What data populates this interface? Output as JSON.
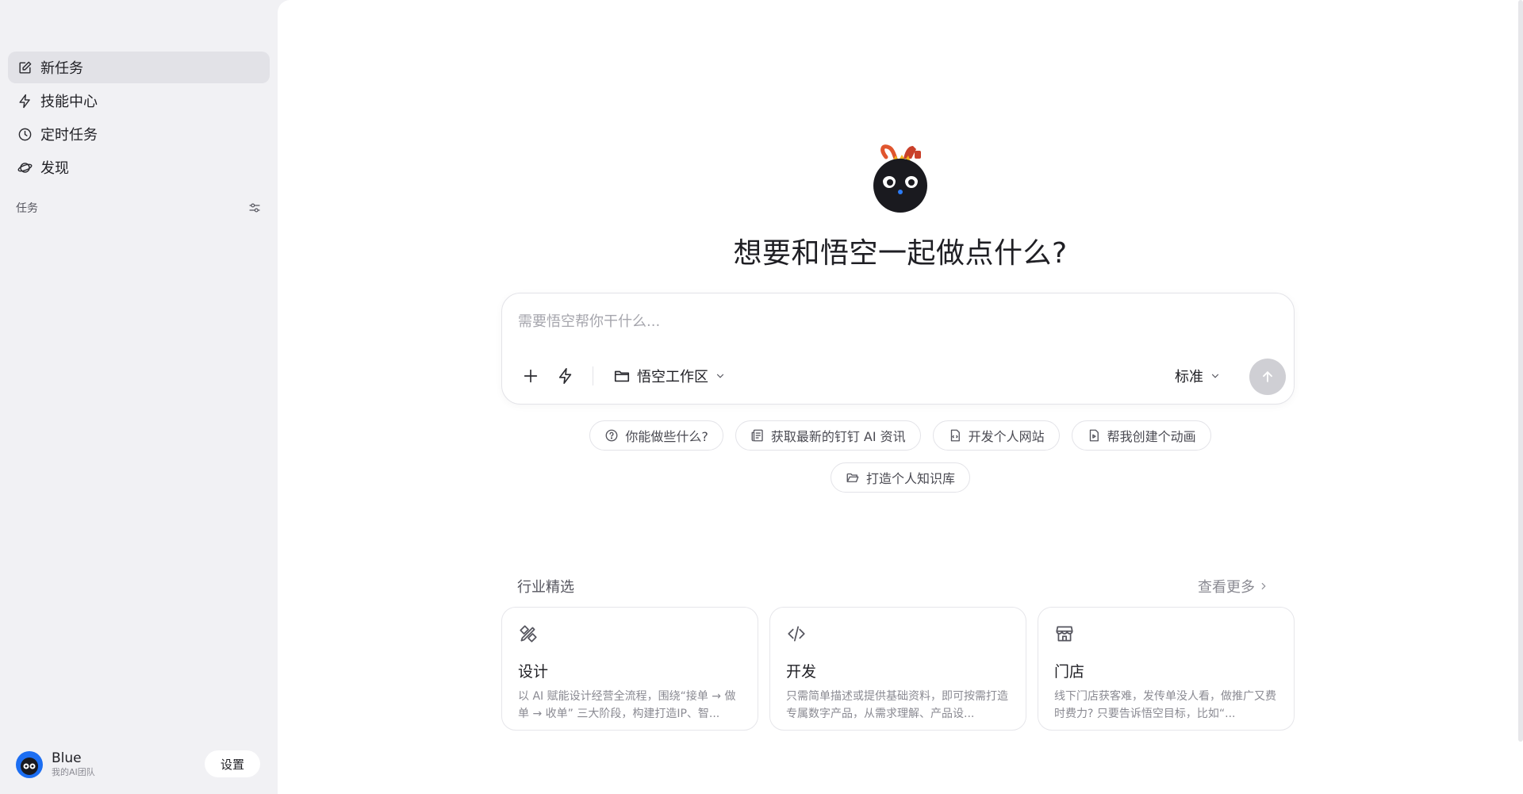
{
  "sidebar": {
    "nav": [
      {
        "label": "新任务",
        "icon": "edit-icon"
      },
      {
        "label": "技能中心",
        "icon": "lightning-icon"
      },
      {
        "label": "定时任务",
        "icon": "clock-icon"
      },
      {
        "label": "发现",
        "icon": "planet-icon"
      }
    ],
    "section_label": "任务",
    "user": {
      "name": "Blue",
      "team": "我的AI团队"
    },
    "settings_label": "设置"
  },
  "main": {
    "headline": "想要和悟空一起做点什么?",
    "composer": {
      "placeholder": "需要悟空帮你干什么...",
      "workspace_label": "悟空工作区",
      "mode_label": "标准"
    },
    "suggestions_row1": [
      "你能做些什么?",
      "获取最新的钉钉 AI 资讯",
      "开发个人网站",
      "帮我创建个动画"
    ],
    "suggestions_row2": [
      "打造个人知识库"
    ],
    "industry": {
      "title": "行业精选",
      "see_more": "查看更多",
      "cards": [
        {
          "title": "设计",
          "desc": "以 AI 赋能设计经营全流程，围绕“接单 → 做单 → 收单” 三大阶段，构建打造IP、智..."
        },
        {
          "title": "开发",
          "desc": "只需简单描述或提供基础资料，即可按需打造专属数字产品，从需求理解、产品设..."
        },
        {
          "title": "门店",
          "desc": "线下门店获客难，发传单没人看，做推广又费时费力? 只要告诉悟空目标，比如“..."
        }
      ]
    }
  },
  "colors": {
    "sidebar_bg": "#f1f1f4",
    "main_bg": "#ffffff",
    "active_nav": "#e2e2e7",
    "send_disabled": "#cfcfd4",
    "avatar": "#1c6ef2"
  }
}
